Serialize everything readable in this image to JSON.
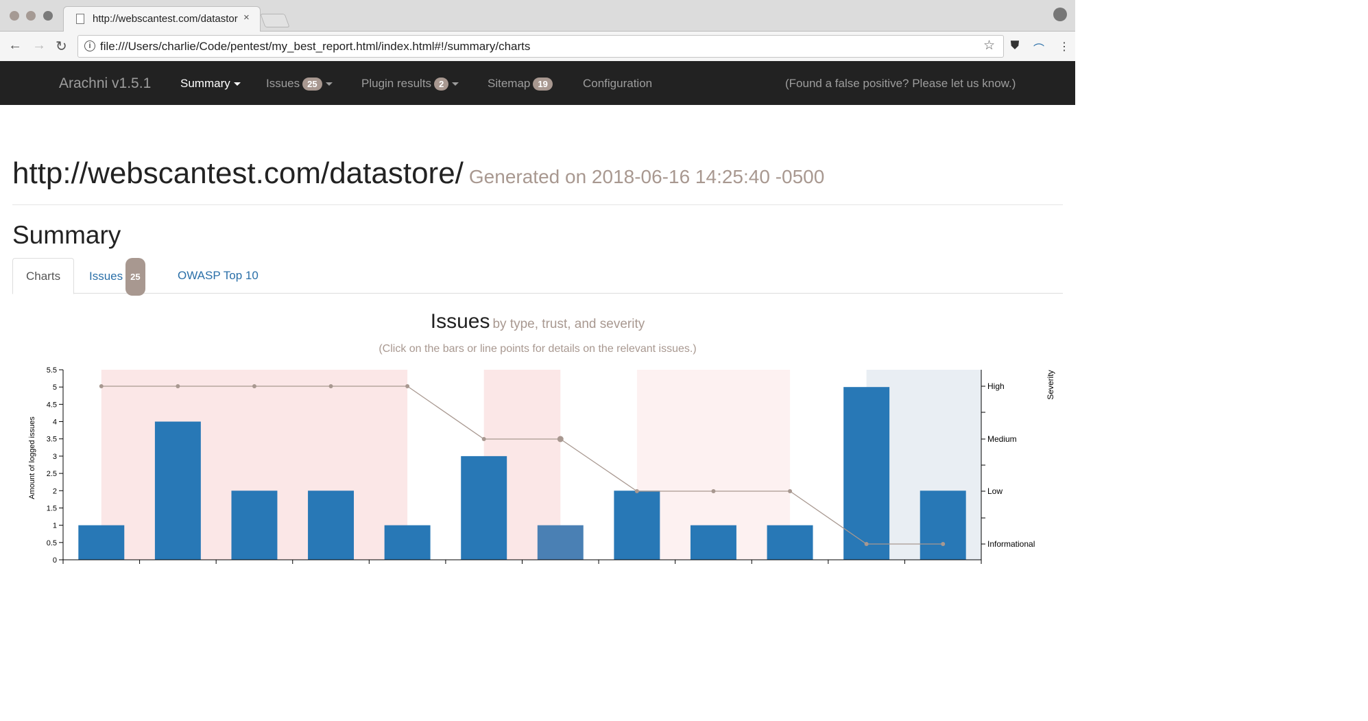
{
  "browser": {
    "tab_title": "http://webscantest.com/datastore/",
    "tab_close": "×",
    "url": "file:///Users/charlie/Code/pentest/my_best_report.html/index.html#!/summary/charts"
  },
  "navbar": {
    "brand": "Arachni v1.5.1",
    "summary": "Summary",
    "issues": "Issues",
    "issues_count": "25",
    "plugins": "Plugin results",
    "plugins_count": "2",
    "sitemap": "Sitemap",
    "sitemap_count": "19",
    "configuration": "Configuration",
    "false_positive": "(Found a false positive? Please let us know.)"
  },
  "header": {
    "title": "http://webscantest.com/datastore/",
    "generated": "Generated on 2018-06-16 14:25:40 -0500"
  },
  "summary": {
    "title": "Summary",
    "tabs": [
      {
        "label": "Charts"
      },
      {
        "label": "Issues",
        "badge": "25"
      },
      {
        "label": "OWASP Top 10"
      }
    ]
  },
  "chart_data": {
    "type": "bar",
    "title": "Issues",
    "subtitle": "by type, trust, and severity",
    "note": "(Click on the bars or line points for details on the relevant issues.)",
    "ylabel": "Amount of logged issues",
    "y2label": "Severity",
    "ylim": [
      0,
      5.5
    ],
    "yticks": [
      "0",
      "0.5",
      "1",
      "1.5",
      "2",
      "2.5",
      "3",
      "3.5",
      "4",
      "4.5",
      "5",
      "5.5"
    ],
    "severity_levels": [
      "Informational",
      "Low",
      "Medium",
      "High"
    ],
    "values": [
      1,
      4,
      2,
      2,
      1,
      3,
      1,
      2,
      1,
      1,
      5,
      2
    ],
    "severity": [
      "High",
      "High",
      "High",
      "High",
      "High",
      "Medium",
      "Medium",
      "Low",
      "Low",
      "Low",
      "Informational",
      "Informational"
    ],
    "untrusted_index": 6,
    "colors": {
      "bar": "#2878b6",
      "bar_untrusted": "#4a80b4",
      "line": "#a89890",
      "bg_high": "#fbe7e7",
      "bg_medium": "#fbe7e7",
      "bg_low": "#fdf1f1",
      "bg_info": "#e9eef3"
    }
  }
}
